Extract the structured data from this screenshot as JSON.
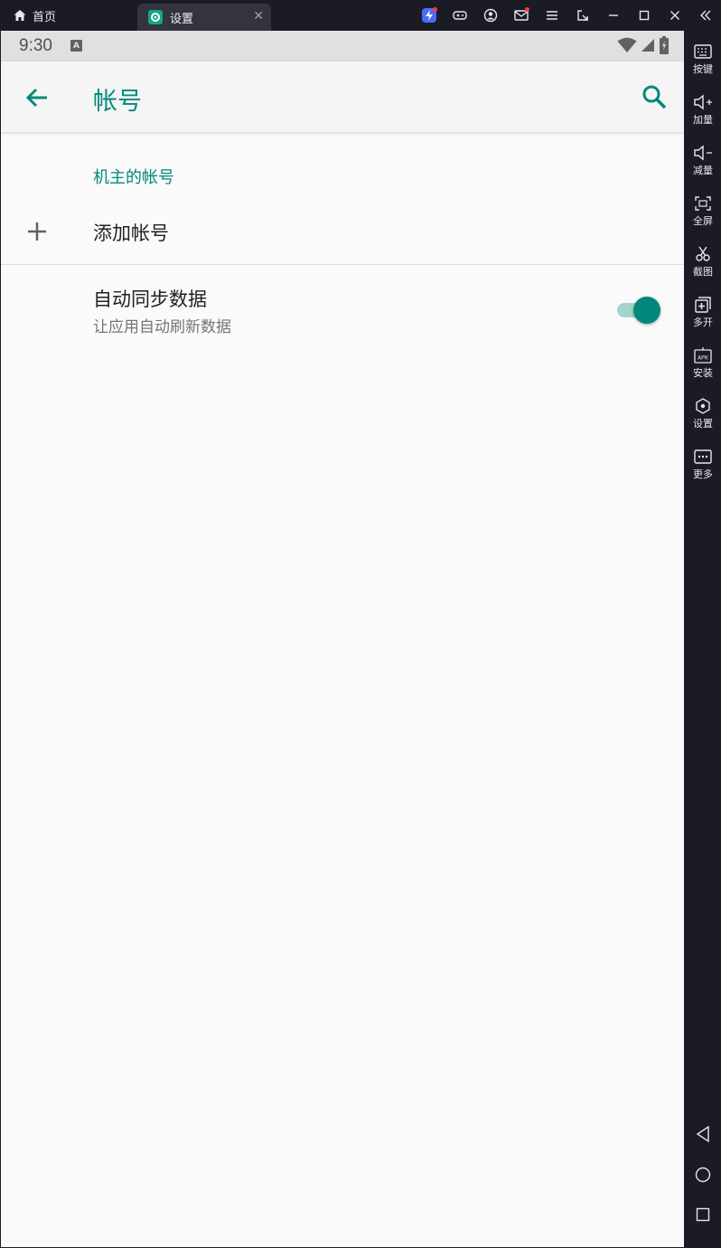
{
  "titlebar": {
    "home_label": "首页",
    "active_tab_label": "设置",
    "close_glyph": "✕"
  },
  "statusbar": {
    "time": "9:30",
    "notif_letter": "A"
  },
  "appbar": {
    "title": "帐号"
  },
  "accounts": {
    "section_header": "机主的帐号",
    "add_account_label": "添加帐号"
  },
  "sync": {
    "title": "自动同步数据",
    "subtitle": "让应用自动刷新数据",
    "enabled": true
  },
  "sidebar": {
    "items": [
      {
        "label": "按键",
        "icon": "keyboard-icon"
      },
      {
        "label": "加量",
        "icon": "volume-up-icon"
      },
      {
        "label": "减量",
        "icon": "volume-down-icon"
      },
      {
        "label": "全屏",
        "icon": "fullscreen-icon"
      },
      {
        "label": "截图",
        "icon": "scissors-icon"
      },
      {
        "label": "多开",
        "icon": "multi-instance-icon"
      },
      {
        "label": "安装",
        "icon": "apk-icon"
      },
      {
        "label": "设置",
        "icon": "settings-icon"
      },
      {
        "label": "更多",
        "icon": "more-icon"
      }
    ]
  },
  "colors": {
    "accent": "#00897b",
    "emulator_bg": "#1b1b25",
    "screen_bg": "#fafafa"
  }
}
